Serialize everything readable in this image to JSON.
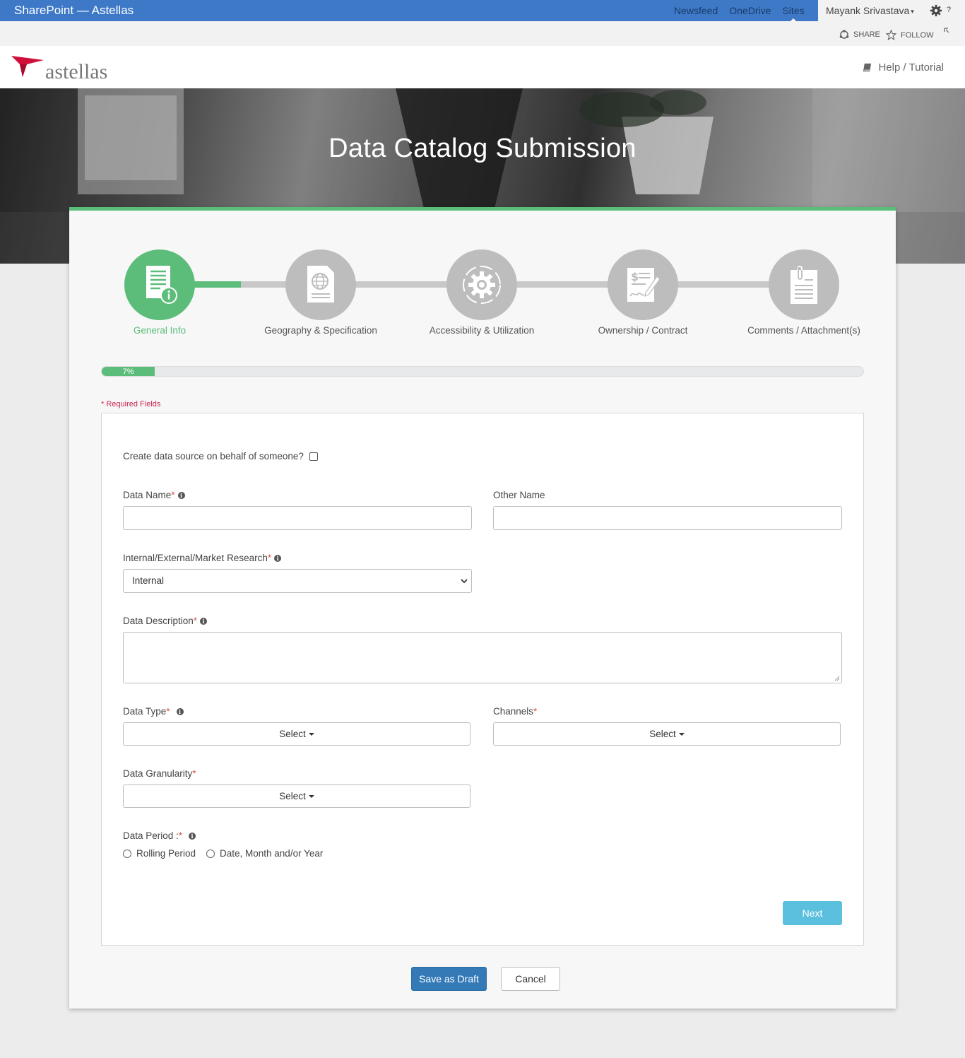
{
  "suite": {
    "title": "SharePoint — Astellas",
    "links": [
      "Newsfeed",
      "OneDrive",
      "Sites"
    ],
    "user": "Mayank Srivastava",
    "accent": "#3e79c8"
  },
  "ribbon": {
    "share": "SHARE",
    "follow": "FOLLOW"
  },
  "header": {
    "logo_text": "astellas",
    "help": "Help / Tutorial"
  },
  "hero": {
    "title": "Data Catalog Submission"
  },
  "steps": [
    {
      "label": "General Info",
      "icon": "document-info-icon",
      "active": true
    },
    {
      "label": "Geography & Specification",
      "icon": "globe-document-icon",
      "active": false
    },
    {
      "label": "Accessibility & Utilization",
      "icon": "gear-cycle-icon",
      "active": false
    },
    {
      "label": "Ownership / Contract",
      "icon": "contract-signature-icon",
      "active": false
    },
    {
      "label": "Comments / Attachment(s)",
      "icon": "clipboard-attachment-icon",
      "active": false
    }
  ],
  "progress": {
    "label": "7%",
    "value": 7
  },
  "required_note": "Required Fields",
  "form": {
    "behalf_label": "Create data source on behalf of someone?",
    "data_name_label": "Data Name",
    "other_name_label": "Other Name",
    "internal_label": "Internal/External/Market Research",
    "internal_value": "Internal",
    "description_label": "Data Description",
    "data_type_label": "Data Type",
    "channels_label": "Channels",
    "granularity_label": "Data Granularity",
    "select_text": "Select",
    "period_label": "Data Period :",
    "period_options": [
      "Rolling Period",
      "Date, Month and/or Year"
    ],
    "next": "Next"
  },
  "actions": {
    "save_draft": "Save as Draft",
    "cancel": "Cancel"
  },
  "colors": {
    "green": "#5cbd7a",
    "primary": "#337ab7",
    "info": "#5bc0de",
    "required": "#d9534f"
  }
}
